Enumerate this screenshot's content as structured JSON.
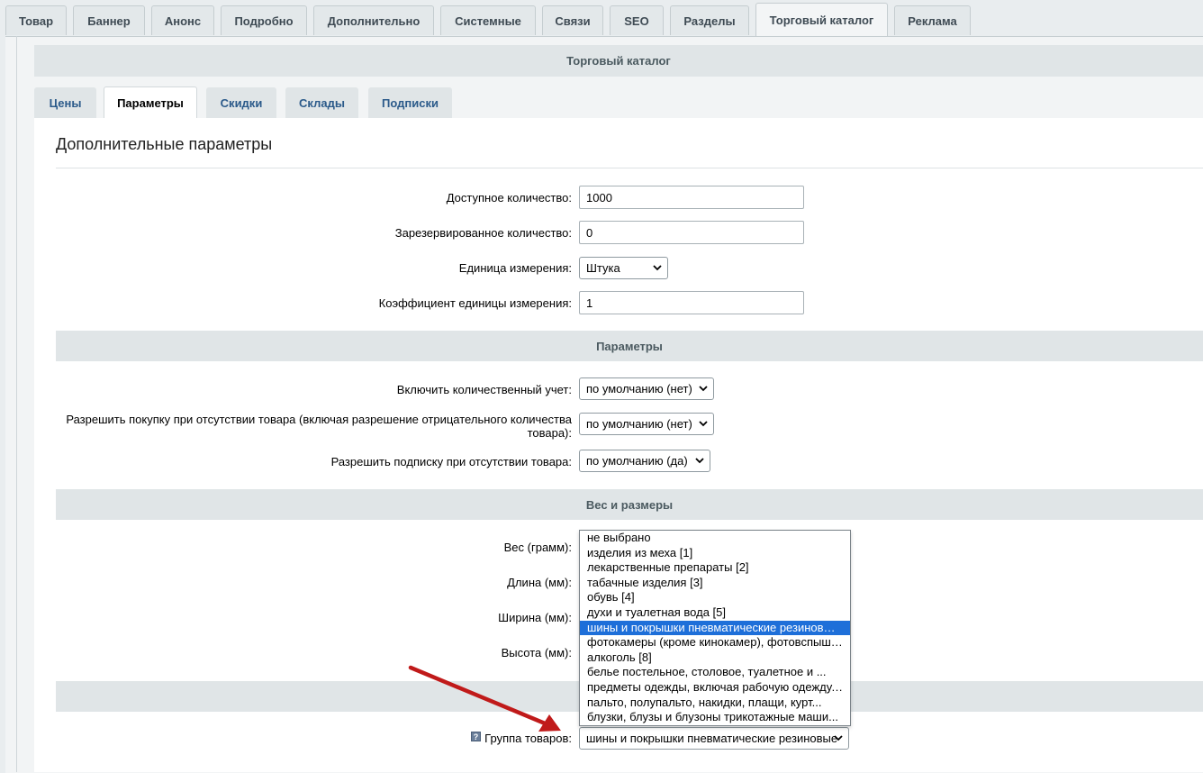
{
  "top_tabs": [
    "Товар",
    "Баннер",
    "Анонс",
    "Подробно",
    "Дополнительно",
    "Системные",
    "Связи",
    "SEO",
    "Разделы",
    "Торговый каталог",
    "Реклама"
  ],
  "top_tab_active": "Торговый каталог",
  "section_title": "Торговый каталог",
  "sub_tabs": [
    "Цены",
    "Параметры",
    "Скидки",
    "Склады",
    "Подписки"
  ],
  "sub_tab_active": "Параметры",
  "page_title": "Дополнительные параметры",
  "fields": {
    "available_qty": {
      "label": "Доступное количество:",
      "value": "1000"
    },
    "reserved_qty": {
      "label": "Зарезервированное количество:",
      "value": "0"
    },
    "unit": {
      "label": "Единица измерения:",
      "value": "Штука"
    },
    "unit_ratio": {
      "label": "Коэффициент единицы измерения:",
      "value": "1"
    }
  },
  "band_params": "Параметры",
  "params": {
    "qty_trace": {
      "label": "Включить количественный учет:",
      "value": "по умолчанию (нет)"
    },
    "can_buy_zero_1": "Разрешить покупку при отсутствии товара (включая разрешение отрицательного количества",
    "can_buy_zero_2": "товара):",
    "can_buy_zero_value": "по умолчанию (нет)",
    "subscribe": {
      "label": "Разрешить подписку при отсутствии товара:",
      "value": "по умолчанию (да)"
    }
  },
  "band_weight": "Вес и размеры",
  "dims": {
    "weight": "Вес (грамм):",
    "length": "Длина (мм):",
    "width": "Ширина (мм):",
    "height": "Высота (мм):"
  },
  "product_group": {
    "label": "Группа товаров:",
    "value": "шины и покрышки пневматические резиновые"
  },
  "dropdown_options": [
    "не выбрано",
    "изделия из меха [1]",
    "лекарственные препараты [2]",
    "табачные изделия [3]",
    "обувь [4]",
    "духи и туалетная вода [5]",
    "шины и покрышки пневматические резиновые...",
    "фотокамеры (кроме кинокамер), фотовспышк...",
    "алкоголь [8]",
    "белье постельное, столовое, туалетное и ...",
    "предметы одежды, включая рабочую одежду,...",
    "пальто, полупальто, накидки, плащи, курт...",
    "блузки, блузы и блузоны трикотажные маши..."
  ],
  "dropdown_highlighted_index": 6,
  "colors": {
    "accent": "#1e6fd9",
    "arrow": "#c01a1a",
    "band": "#e0e5e7"
  }
}
